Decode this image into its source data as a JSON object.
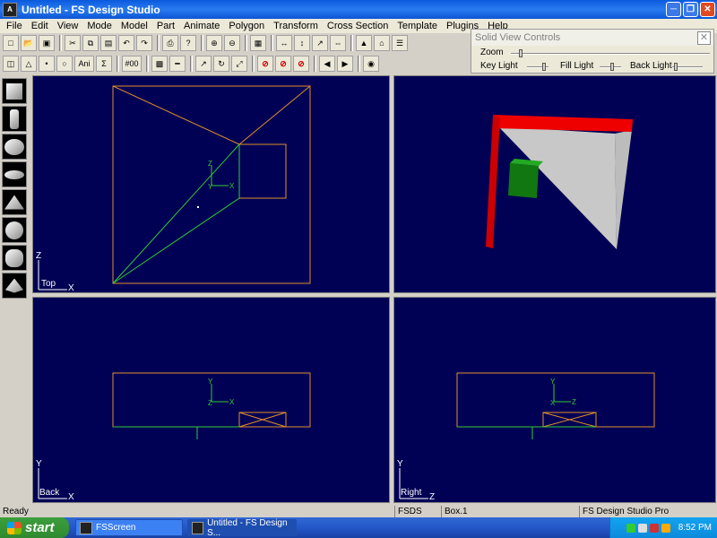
{
  "window": {
    "title": "Untitled - FS Design Studio"
  },
  "menu": [
    "File",
    "Edit",
    "View",
    "Mode",
    "Model",
    "Part",
    "Animate",
    "Polygon",
    "Transform",
    "Cross Section",
    "Template",
    "Plugins",
    "Help"
  ],
  "toolbar1": [
    "new",
    "open",
    "save",
    "cut",
    "copy",
    "paste",
    "undo",
    "redo",
    "print",
    "help",
    "zoom-in",
    "zoom-out",
    "grid",
    "scale-x",
    "scale-y",
    "scale-z",
    "scale-xz",
    "tree",
    "home",
    "tool"
  ],
  "toolbar2_labels": {
    "ani": "Ani",
    "sigma": "Σ",
    "num": "#00"
  },
  "solid_view": {
    "title": "Solid View Controls",
    "zoom_label": "Zoom",
    "key_label": "Key Light",
    "fill_label": "Fill Light",
    "back_label": "Back Light",
    "zoom_value": 0.04,
    "key_value": 0.85,
    "fill_value": 0.6,
    "back_value": 0.05
  },
  "viewports": {
    "top": {
      "label": "Top",
      "axis_v": "Z",
      "axis_h": "X"
    },
    "back": {
      "label": "Back",
      "axis_v": "Y",
      "axis_h": "X"
    },
    "right": {
      "label": "Right",
      "axis_v": "Y",
      "axis_h": "Z"
    }
  },
  "gizmo": {
    "top": [
      "Z",
      "Y",
      "X"
    ],
    "back": [
      "Y",
      "Z",
      "X"
    ],
    "right": [
      "Y",
      "X",
      "Z"
    ]
  },
  "status": {
    "left": "Ready",
    "model": "FSDS Model",
    "object": "Box.1",
    "product": "FS Design Studio Pro"
  },
  "taskbar": {
    "start": "start",
    "tasks": [
      "FSScreen",
      "Untitled - FS Design S..."
    ],
    "clock": "8:52 PM"
  },
  "colors": {
    "viewport_bg": "#000055",
    "wire_orange": "#e0902a",
    "wire_green": "#33cc33",
    "solid_red": "#ee0000",
    "solid_gray": "#c8c8c8",
    "solid_green": "#117711"
  }
}
